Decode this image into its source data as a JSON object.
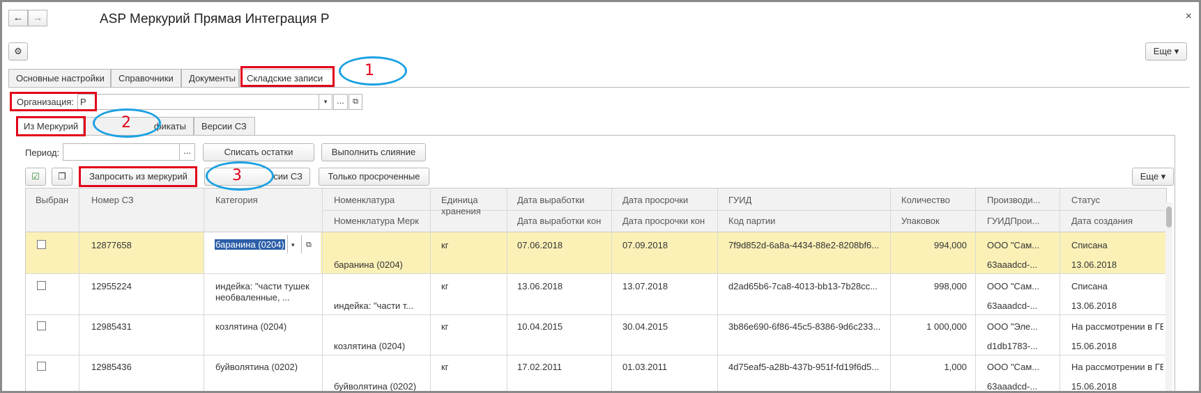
{
  "window": {
    "title": "ASP Меркурий Прямая Интеграция Р",
    "back_icon": "←",
    "forward_icon": "→",
    "close_icon": "×"
  },
  "toolbar": {
    "settings_icon": "⚙",
    "more_label": "Еще ▾"
  },
  "tabs": [
    {
      "label": "Основные настройки"
    },
    {
      "label": "Справочники"
    },
    {
      "label": "Документы"
    },
    {
      "label": "Складские записи",
      "active": true
    }
  ],
  "organization": {
    "label": "Организация:",
    "value": "Р"
  },
  "subtabs": [
    {
      "label": "Из Меркурий",
      "active": true
    },
    {
      "label": "фикаты"
    },
    {
      "label": "Версии СЗ"
    }
  ],
  "period": {
    "label": "Период:",
    "value": ""
  },
  "buttons": {
    "write_off": "Списать остатки",
    "merge": "Выполнить слияние",
    "request": "Запросить из меркурий",
    "versions": "сии СЗ",
    "overdue_only": "Только просроченные",
    "more": "Еще ▾"
  },
  "callouts": [
    "1",
    "2",
    "3"
  ],
  "columns": {
    "selected": "Выбран",
    "number": "Номер СЗ",
    "category": "Категория",
    "nomenclature": "Номенклатура",
    "nomenclature_merc": "Номенклатура Мерк",
    "unit": "Единица хранения",
    "prod_date": "Дата выработки",
    "prod_date_end": "Дата выработки кон",
    "exp_date": "Дата просрочки",
    "exp_date_end": "Дата просрочки кон",
    "guid": "ГУИД",
    "batch_code": "Код партии",
    "quantity": "Количество",
    "packages": "Упаковок",
    "producer": "Производи...",
    "producer_guid": "ГУИДПрои...",
    "status": "Статус",
    "created": "Дата создания"
  },
  "rows": [
    {
      "number": "12877658",
      "category": "баранина (0204)",
      "nomenclature_merc": "баранина (0204)",
      "unit": "кг",
      "prod_date": "07.06.2018",
      "exp_date": "07.09.2018",
      "guid": "7f9d852d-6a8a-4434-88e2-8208bf6...",
      "quantity": "994,000",
      "producer": "ООО \"Сам...",
      "producer_guid": "63aaadcd-...",
      "status": "Списана",
      "created": "13.06.2018"
    },
    {
      "number": "12955224",
      "category": "индейка: \"части тушек необваленные, ...",
      "nomenclature_merc": "индейка: \"части т...",
      "unit": "кг",
      "prod_date": "13.06.2018",
      "exp_date": "13.07.2018",
      "guid": "d2ad65b6-7ca8-4013-bb13-7b28cc...",
      "quantity": "998,000",
      "producer": "ООО \"Сам...",
      "producer_guid": "63aaadcd-...",
      "status": "Списана",
      "created": "13.06.2018"
    },
    {
      "number": "12985431",
      "category": "козлятина (0204)",
      "nomenclature_merc": "козлятина (0204)",
      "unit": "кг",
      "prod_date": "10.04.2015",
      "exp_date": "30.04.2015",
      "guid": "3b86e690-6f86-45c5-8386-9d6c233...",
      "quantity": "1 000,000",
      "producer": "ООО \"Эле...",
      "producer_guid": "d1db1783-...",
      "status": "На рассмотрении в ГВЭ",
      "created": "15.06.2018"
    },
    {
      "number": "12985436",
      "category": "буйволятина (0202)",
      "nomenclature_merc": "буйволятина (0202)",
      "unit": "кг",
      "prod_date": "17.02.2011",
      "exp_date": "01.03.2011",
      "guid": "4d75eaf5-a28b-437b-951f-fd19f6d5...",
      "quantity": "1,000",
      "producer": "ООО \"Сам...",
      "producer_guid": "63aaadcd-...",
      "status": "На рассмотрении в ГВЭ",
      "created": "15.06.2018"
    }
  ]
}
